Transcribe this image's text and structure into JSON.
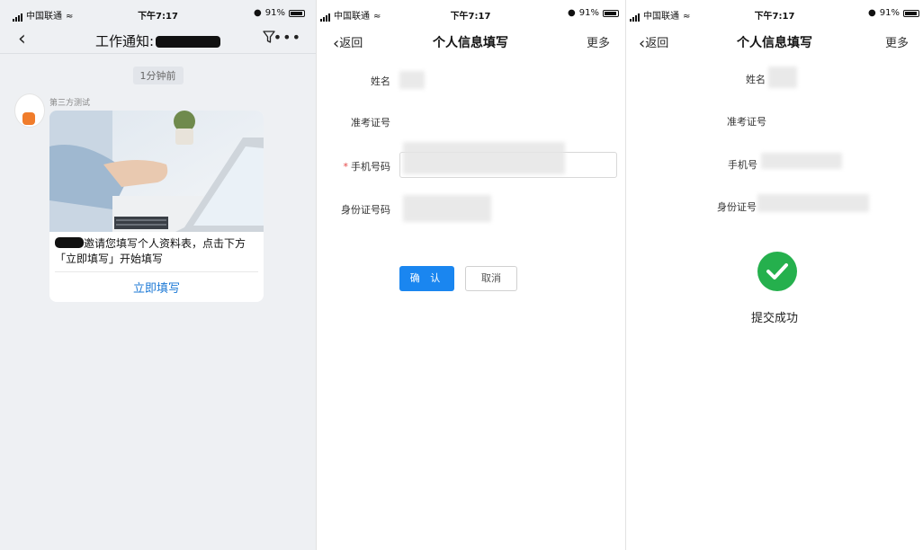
{
  "colors": {
    "accent": "#1a86f0",
    "success": "#25b04d",
    "required": "#e54545",
    "link": "#1e7ad6"
  },
  "status": {
    "carrier": "中国联通",
    "time": "下午7:17",
    "battery": "91%"
  },
  "chat": {
    "title_prefix": "工作通知:",
    "time_chip": "1分钟前",
    "sender": "第三方测试",
    "message": "邀请您填写个人资料表，点击下方「立即填写」开始填写",
    "action": "立即填写",
    "icons": [
      "back-icon",
      "filter-icon",
      "more-icon"
    ]
  },
  "form": {
    "back": "返回",
    "title": "个人信息填写",
    "more": "更多",
    "labels": {
      "name": "姓名",
      "exam_id": "准考证号",
      "phone": "手机号码",
      "id_card": "身份证号码"
    },
    "confirm": "确 认",
    "cancel": "取消"
  },
  "result": {
    "back": "返回",
    "title": "个人信息填写",
    "more": "更多",
    "labels": {
      "name": "姓名",
      "exam_id": "准考证号",
      "phone": "手机号",
      "id_card": "身份证号"
    },
    "success": "提交成功"
  }
}
